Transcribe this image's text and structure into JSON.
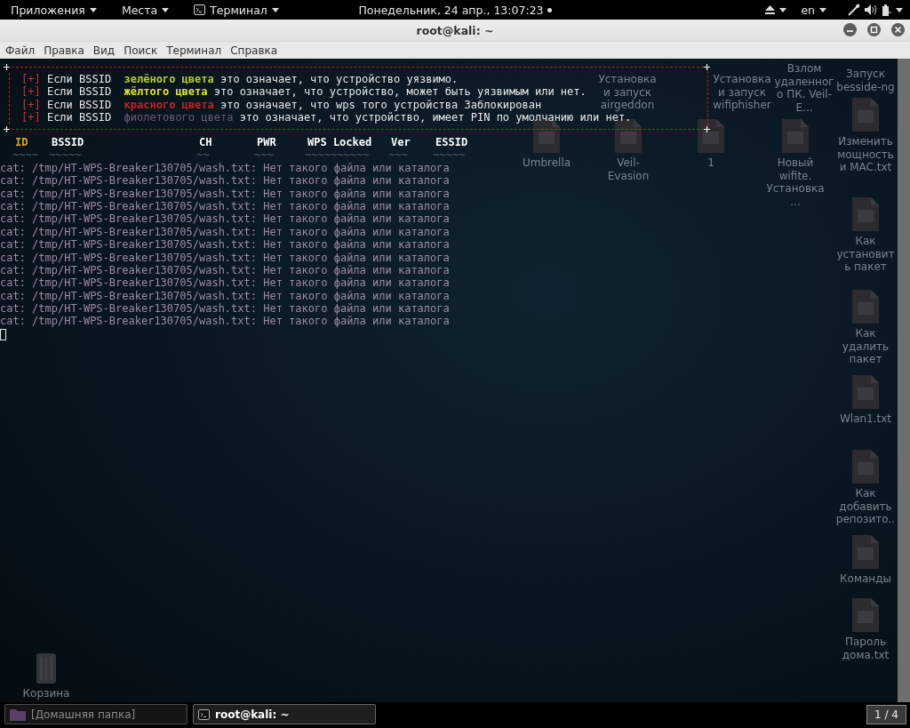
{
  "top_bar": {
    "menus": [
      {
        "label": "Приложения",
        "kind": "plain"
      },
      {
        "label": "Места",
        "kind": "plain"
      },
      {
        "label": "Терминал",
        "kind": "terminal"
      }
    ],
    "clock": "Понедельник, 24 апр., 13:07:23",
    "language": "en"
  },
  "window": {
    "title": "root@kali: ~",
    "menu": [
      "Файл",
      "Правка",
      "Вид",
      "Поиск",
      "Терминал",
      "Справка"
    ]
  },
  "terminal": {
    "legend": [
      {
        "marker": "[+]",
        "prefix": "Если BSSID",
        "colored_text": "зелёного цвета",
        "color": "#b5cf24",
        "bold": true,
        "text": "это означает, что устройство уязвимо."
      },
      {
        "marker": "[+]",
        "prefix": "Если BSSID",
        "colored_text": "жёлтого цвета",
        "color": "#e2e22c",
        "bold": true,
        "text": "это означает, что устройство, может быть уязвимым или нет."
      },
      {
        "marker": "[+]",
        "prefix": "Если BSSID",
        "colored_text": "красного цвета",
        "color": "#c82020",
        "bold": true,
        "text": "это означает, что wps того устройства Заблокирован"
      },
      {
        "marker": "[+]",
        "prefix": "Если BSSID",
        "colored_text": "фиолетового цвета",
        "color": "#6c5a78",
        "bold": false,
        "text": "это означает, что устройство, имеет PIN по умолчанию или нет."
      }
    ],
    "columns": [
      {
        "label": "ID",
        "underline": "~~~~",
        "color": "#d8a818"
      },
      {
        "label": "BSSID",
        "underline": "~~~~~",
        "color": "#ffffff"
      },
      {
        "label": "CH",
        "underline": "~~",
        "color": "#ffffff"
      },
      {
        "label": "PWR",
        "underline": "~~~",
        "color": "#ffffff"
      },
      {
        "label": "WPS Locked",
        "underline": "~~~~~~~~~~",
        "color": "#ffffff"
      },
      {
        "label": "Ver",
        "underline": "~~~",
        "color": "#ffffff"
      },
      {
        "label": "ESSID",
        "underline": "~~~~~",
        "color": "#ffffff"
      }
    ],
    "lines": [
      "cat: /tmp/HT-WPS-Breaker130705/wash.txt: Нет такого файла или каталога",
      "cat: /tmp/HT-WPS-Breaker130705/wash.txt: Нет такого файла или каталога",
      "cat: /tmp/HT-WPS-Breaker130705/wash.txt: Нет такого файла или каталога",
      "cat: /tmp/HT-WPS-Breaker130705/wash.txt: Нет такого файла или каталога",
      "cat: /tmp/HT-WPS-Breaker130705/wash.txt: Нет такого файла или каталога",
      "cat: /tmp/HT-WPS-Breaker130705/wash.txt: Нет такого файла или каталога",
      "cat: /tmp/HT-WPS-Breaker130705/wash.txt: Нет такого файла или каталога",
      "cat: /tmp/HT-WPS-Breaker130705/wash.txt: Нет такого файла или каталога",
      "cat: /tmp/HT-WPS-Breaker130705/wash.txt: Нет такого файла или каталога",
      "cat: /tmp/HT-WPS-Breaker130705/wash.txt: Нет такого файла или каталога",
      "cat: /tmp/HT-WPS-Breaker130705/wash.txt: Нет такого файла или каталога",
      "cat: /tmp/HT-WPS-Breaker130705/wash.txt: Нет такого файла или каталога",
      "cat: /tmp/HT-WPS-Breaker130705/wash.txt: Нет такого файла или каталога"
    ]
  },
  "desktop_icons": [
    {
      "label": "Установка и запуск airgeddon",
      "kind": "label_only"
    },
    {
      "label": "Установка и запуск wifiphisher",
      "kind": "label_only"
    },
    {
      "label": "Взлом удаленного ПК. Veil-E...",
      "kind": "label_only"
    },
    {
      "label": "Запуск besside-ng",
      "kind": "label_only"
    },
    {
      "label": "Umbrella",
      "kind": "file"
    },
    {
      "label": "Veil-Evasion",
      "kind": "file"
    },
    {
      "label": "1",
      "kind": "file"
    },
    {
      "label": "Новый wifite. Установка...",
      "kind": "file"
    },
    {
      "label": "Изменить мощность и MAC.txt",
      "kind": "file"
    },
    {
      "label": "Как установить пакет",
      "kind": "file"
    },
    {
      "label": "Как удалить пакет",
      "kind": "file"
    },
    {
      "label": "Wlan1.txt",
      "kind": "file"
    },
    {
      "label": "Как добавить репозито...",
      "kind": "file"
    },
    {
      "label": "Команды",
      "kind": "file"
    },
    {
      "label": "Пароль дома.txt",
      "kind": "file"
    },
    {
      "label": "Корзина",
      "kind": "trash"
    }
  ],
  "taskbar": {
    "items": [
      {
        "label": "[Домашняя папка]",
        "kind": "folder",
        "selected": false
      },
      {
        "label": "root@kali: ~",
        "kind": "terminal",
        "selected": true
      }
    ],
    "workspace": "1 / 4"
  }
}
